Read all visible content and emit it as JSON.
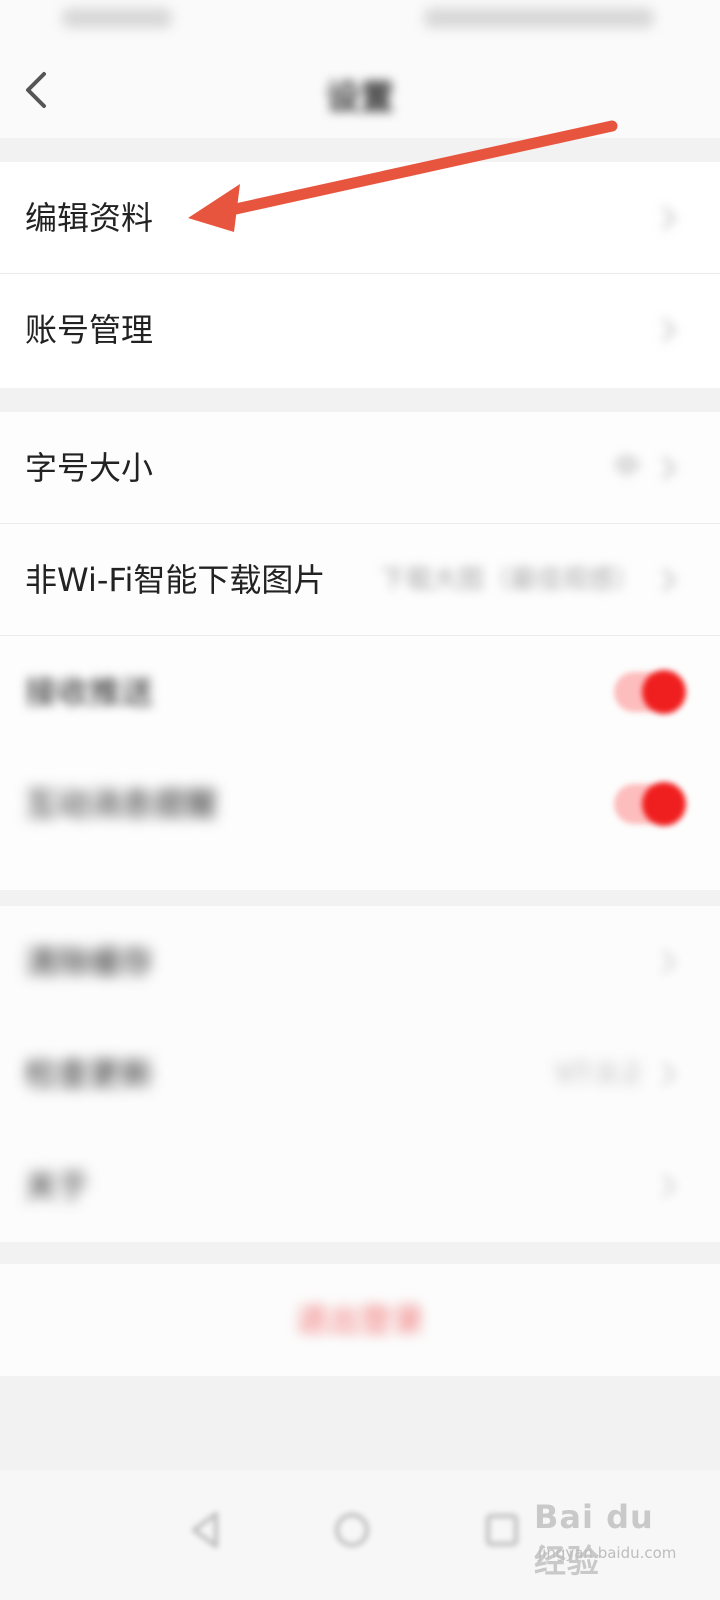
{
  "header": {
    "title": "设置"
  },
  "sections": [
    {
      "items": [
        {
          "label": "编辑资料"
        },
        {
          "label": "账号管理"
        }
      ]
    },
    {
      "items": [
        {
          "label": "字号大小",
          "value": "中"
        },
        {
          "label": "非Wi-Fi智能下载图片",
          "value": "下载大图（最佳观感）"
        },
        {
          "label": "接收推送",
          "toggle_on": true
        },
        {
          "label": "互动消息提醒",
          "toggle_on": true
        }
      ]
    },
    {
      "items": [
        {
          "label": "清除缓存"
        },
        {
          "label": "检查更新",
          "value": "V7.0.2"
        },
        {
          "label": "关于"
        }
      ]
    }
  ],
  "logout": {
    "label": "退出登录"
  },
  "watermark": {
    "brand": "Bai du 经验",
    "url": "jingyan.baidu.com"
  },
  "colors": {
    "accent_red": "#f01f1f",
    "arrow_red": "#e8553f"
  }
}
